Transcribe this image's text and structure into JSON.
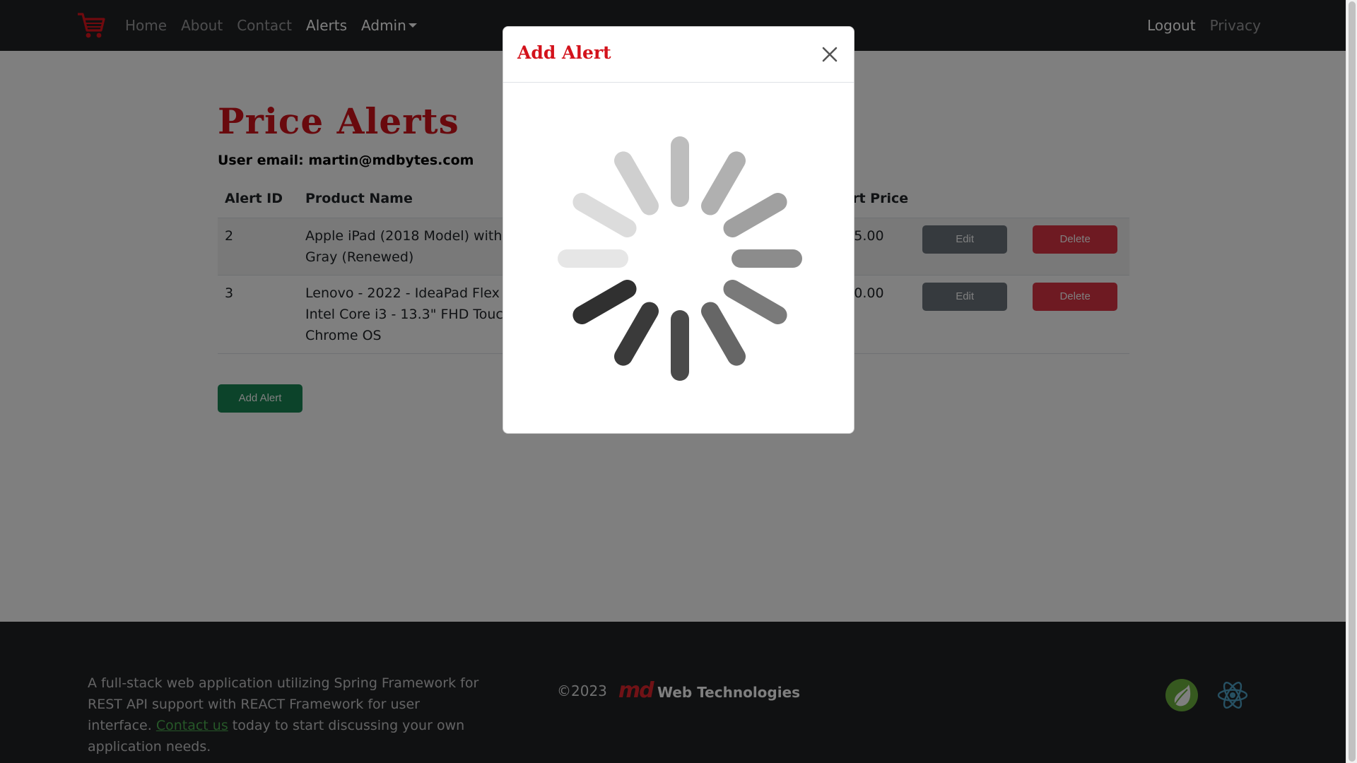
{
  "nav": {
    "brand_icon": "shopping-cart-icon",
    "left_links": [
      "Home",
      "About",
      "Contact",
      "Alerts"
    ],
    "admin_label": "Admin",
    "right_links": [
      "Logout",
      "Privacy"
    ]
  },
  "page": {
    "title": "Price Alerts",
    "user_email": "User email: martin@mdbytes.com"
  },
  "table": {
    "headers": {
      "id": "Alert ID",
      "name": "Product Name",
      "price": "Alert Price"
    },
    "rows": [
      {
        "id": "2",
        "name": "Apple iPad (2018 Model) with Wi-Fi only 32GB Apple 9.7in iPad - Space Gray (Renewed)",
        "price": "$155.00",
        "edit_label": "Edit",
        "delete_label": "Delete"
      },
      {
        "id": "3",
        "name": "Lenovo - 2022 - IdeaPad Flex 5 - 2-in-1 Chromebook Laptop Computer - Intel Core i3 - 13.3\" FHD Touch Display - 8GB Memory - 128GB eMMC - Chrome OS",
        "price": "$380.00",
        "edit_label": "Edit",
        "delete_label": "Delete"
      }
    ]
  },
  "add_alert_label": "Add Alert",
  "footer": {
    "text_before": "A full-stack web application utilizing Spring Framework for REST API support with REACT Framework for user interface. ",
    "contact_link": "Contact us",
    "text_after": " today to start discussing your own application needs.",
    "copyright": "©2023",
    "logo_text": "md",
    "company": "Web Technologies",
    "tech_icons": [
      "spring-leaf-icon",
      "react-atom-icon"
    ]
  },
  "modal": {
    "title": "Add Alert",
    "close_icon": "close-icon",
    "loading_icon": "loading-spinner-icon"
  },
  "colors": {
    "brand_red": "#d3121b",
    "navbar": "#202225",
    "success": "#198754",
    "danger": "#dc3545",
    "secondary": "#6c757d"
  }
}
